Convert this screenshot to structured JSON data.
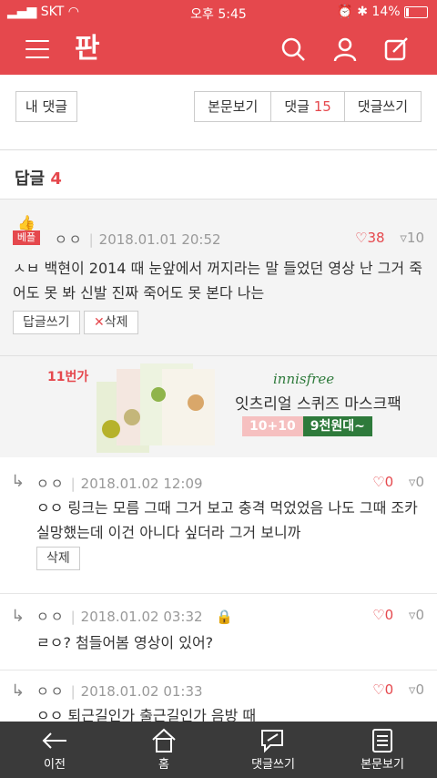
{
  "status": {
    "carrier": "SKT",
    "time": "오후 5:45",
    "battery": "14%"
  },
  "appbar": {
    "logo": "판"
  },
  "toolbar": {
    "my_comments": "내 댓글",
    "view_body": "본문보기",
    "comments_label": "댓글",
    "comments_count": "15",
    "write_comment": "댓글쓰기"
  },
  "section": {
    "title": "답글",
    "count": "4"
  },
  "best_comment": {
    "badge": "베플",
    "author": "ㅇㅇ",
    "date": "2018.01.01 20:52",
    "likes": "38",
    "dislikes": "10",
    "text": "ㅅㅂ 백현이 2014 때 눈앞에서 꺼지라는 말 들었던 영상 난 그거 죽어도 못 봐 신발 진짜 죽어도 못 본다 나는",
    "reply_label": "답글쓰기",
    "delete_label": "삭제"
  },
  "ad": {
    "store": "11번가",
    "brand": "innisfree",
    "headline": "잇츠리얼 스퀴즈 마스크팩",
    "deal_left": "10+10",
    "deal_right": "9천원대~"
  },
  "replies": [
    {
      "author": "ㅇㅇ",
      "date": "2018.01.02 12:09",
      "likes": "0",
      "dislikes": "0",
      "text": "ㅇㅇ 링크는 모름 그때 그거 보고 충격 먹었었음 나도 그때 조카 실망했는데 이건 아니다 싶더라 그거 보니까",
      "action": "삭제"
    },
    {
      "author": "ㅇㅇ",
      "date": "2018.01.02 03:32",
      "likes": "0",
      "dislikes": "0",
      "text": "ㄹㅇ? 첨들어봄 영상이 있어?"
    },
    {
      "author": "ㅇㅇ",
      "date": "2018.01.02 01:33",
      "likes": "0",
      "dislikes": "0",
      "text": "ㅇㅇ 퇴근길인가 출근길인가 음방 때"
    }
  ],
  "bottom_nav": {
    "prev": "이전",
    "home": "홈",
    "write": "댓글쓰기",
    "body": "본문보기"
  },
  "colors": {
    "accent": "#e5484d",
    "nav_bg": "#3a3a3a"
  }
}
